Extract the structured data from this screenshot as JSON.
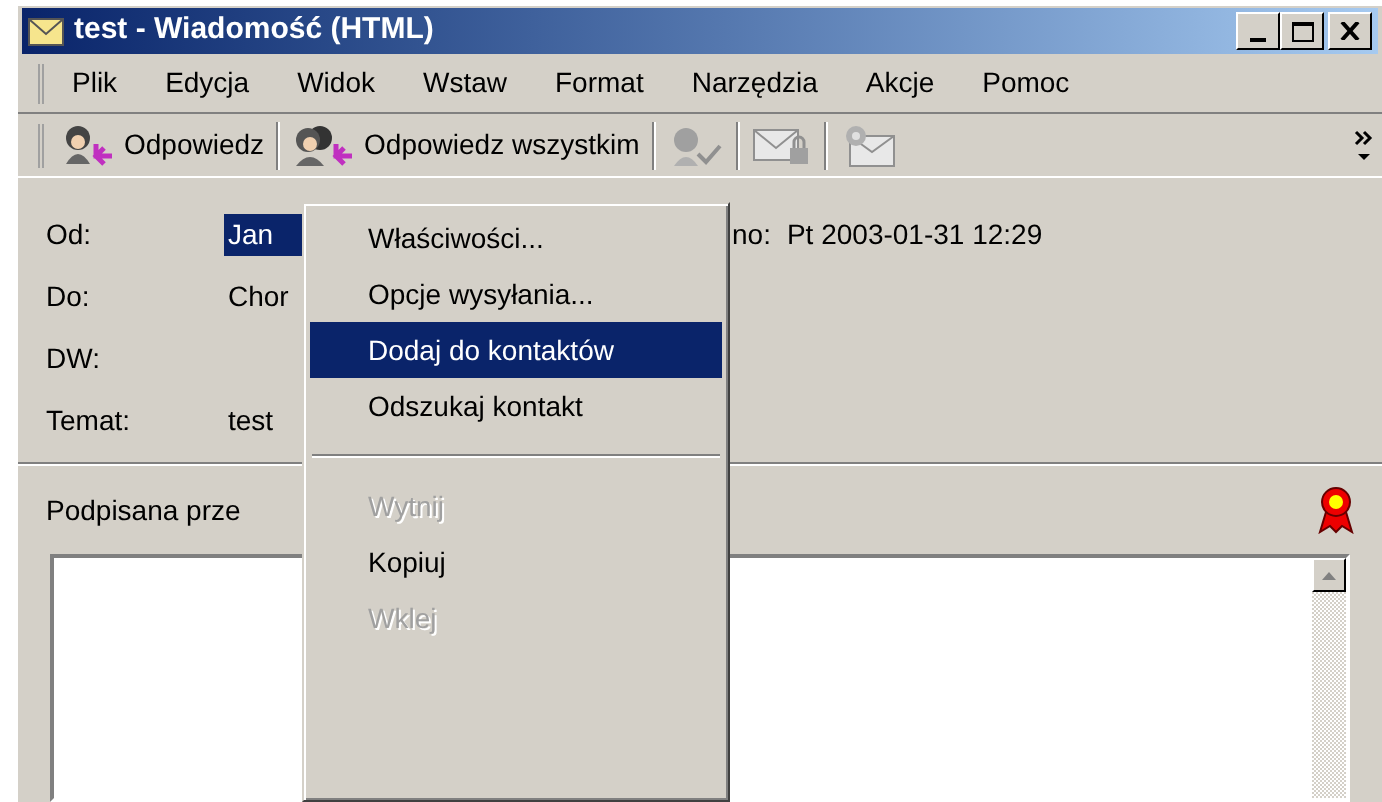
{
  "window": {
    "title": "test - Wiadomość (HTML)"
  },
  "menu_bar": [
    {
      "label": "Plik"
    },
    {
      "label": "Edycja"
    },
    {
      "label": "Widok"
    },
    {
      "label": "Wstaw"
    },
    {
      "label": "Format"
    },
    {
      "label": "Narzędzia"
    },
    {
      "label": "Akcje"
    },
    {
      "label": "Pomoc"
    }
  ],
  "toolbar": [
    {
      "kind": "button",
      "label": "Odpowiedz"
    },
    {
      "kind": "button",
      "label": "Odpowiedz wszystkim"
    },
    {
      "kind": "icon"
    },
    {
      "kind": "icon"
    },
    {
      "kind": "icon"
    }
  ],
  "header": {
    "fields": [
      {
        "label": "Od:",
        "value": "Jan",
        "selected": true
      },
      {
        "label": "Do:",
        "value": "Chor",
        "selected": false
      },
      {
        "label": "DW:",
        "selected": false
      },
      {
        "label": "Temat:",
        "value": "test",
        "selected": false
      }
    ],
    "sent_label": "no:",
    "sent_value": "Pt 2003-01-31 12:29"
  },
  "signature_bar": {
    "text": "Podpisana prze"
  },
  "context_menu": [
    {
      "kind": "item",
      "label": "Właściwości...",
      "selected": false,
      "disabled": false
    },
    {
      "kind": "item",
      "label": "Opcje wysyłania...",
      "selected": false,
      "disabled": false
    },
    {
      "kind": "item",
      "label": "Dodaj do kontaktów",
      "selected": true,
      "disabled": false
    },
    {
      "kind": "item",
      "label": "Odszukaj kontakt",
      "selected": false,
      "disabled": false
    },
    {
      "kind": "separator"
    },
    {
      "kind": "item",
      "label": "Wytnij",
      "selected": false,
      "disabled": true
    },
    {
      "kind": "item",
      "label": "Kopiuj",
      "selected": false,
      "disabled": false
    },
    {
      "kind": "item",
      "label": "Wklej",
      "selected": false,
      "disabled": true
    }
  ]
}
